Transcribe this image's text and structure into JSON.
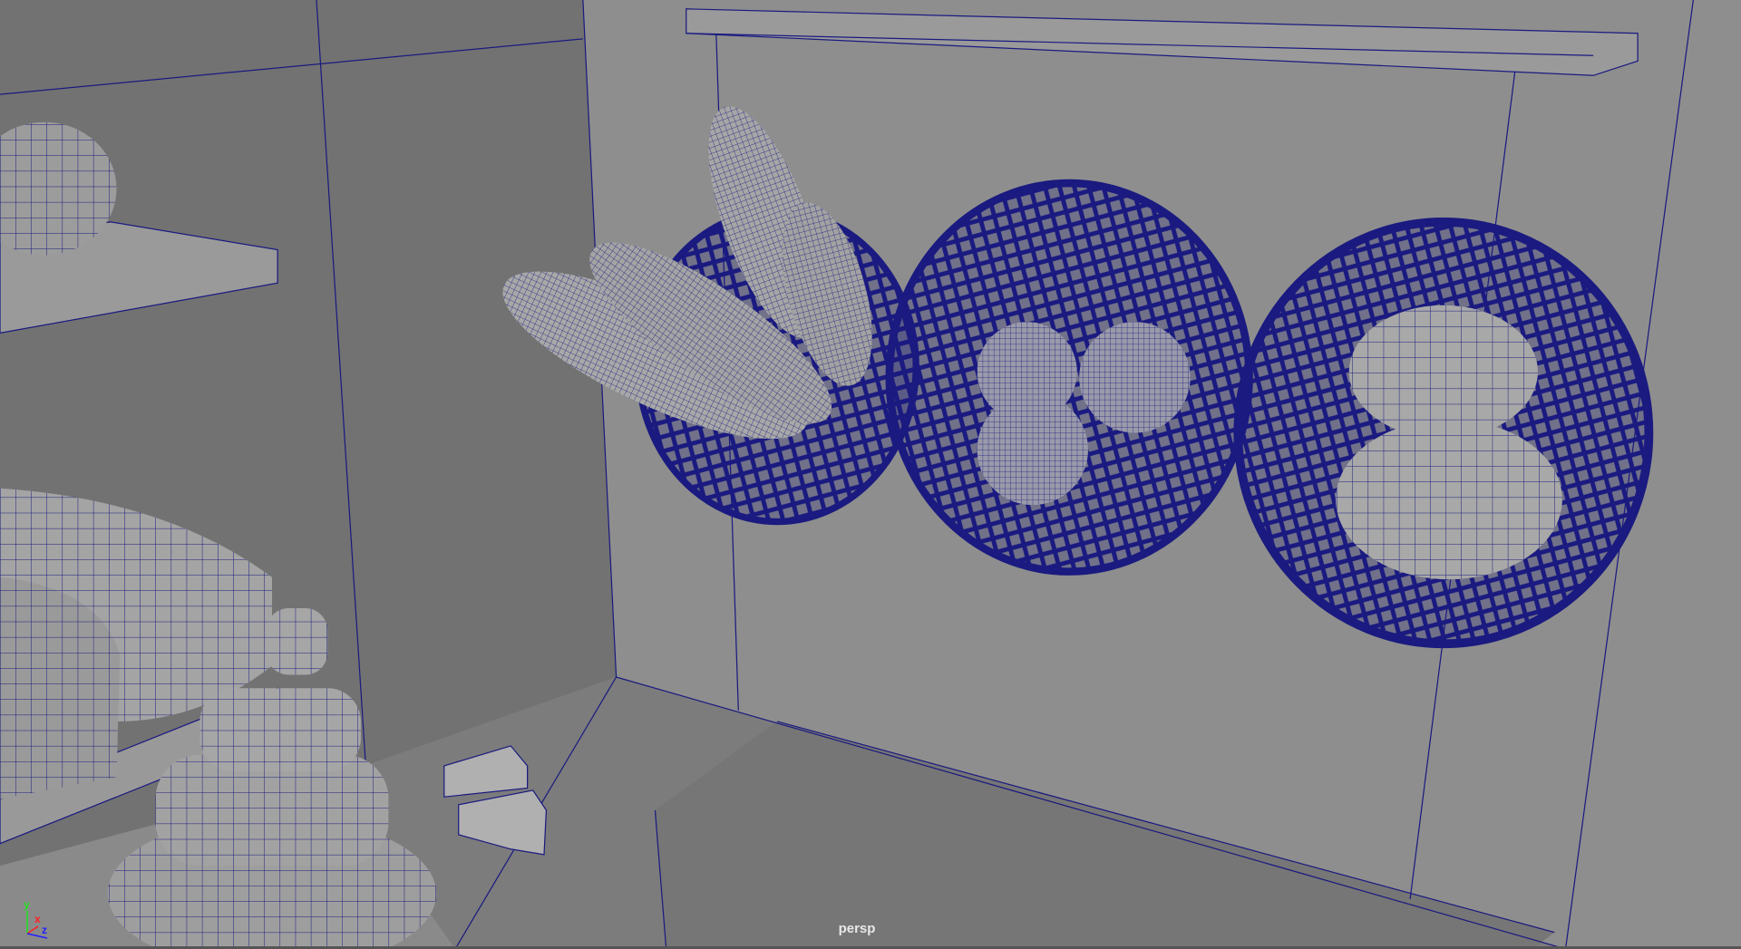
{
  "viewport": {
    "camera_label": "persp",
    "axes": {
      "x": "x",
      "y": "y",
      "z": "z"
    },
    "colors": {
      "background": "#7a7a7a",
      "wireframe": "#1a1a80",
      "x_axis": "#ff2020",
      "y_axis": "#20e020",
      "z_axis": "#2020ff"
    }
  }
}
